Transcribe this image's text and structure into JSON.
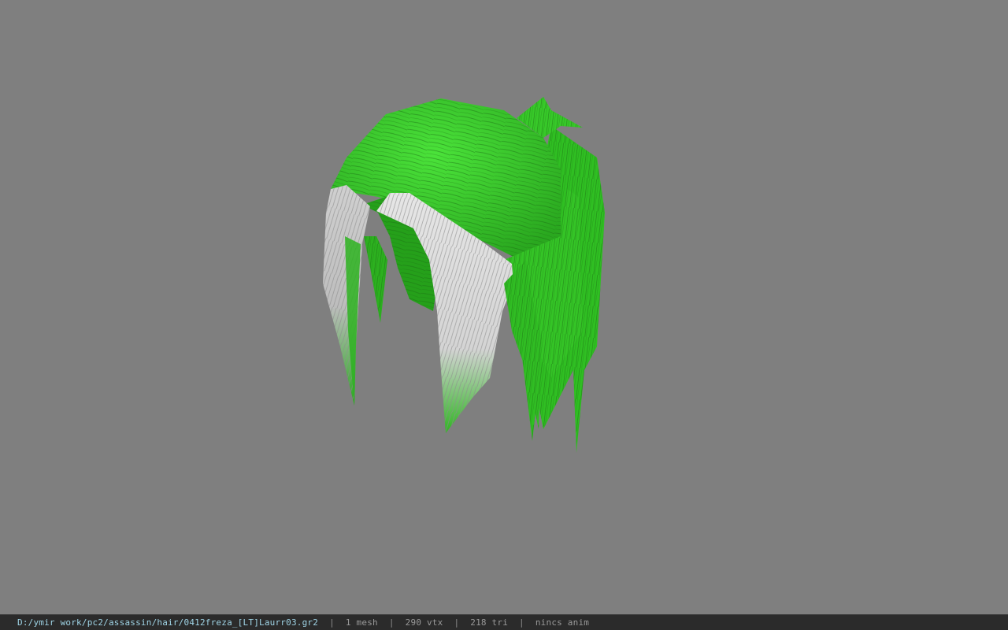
{
  "statusbar": {
    "path": "D:/ymir work/pc2/assassin/hair/0412freza_[LT]Laurr03.gr2",
    "separator": "|",
    "meshes": "1 mesh",
    "vertices": "290 vtx",
    "triangles": "218 tri",
    "animation": "nincs anim"
  },
  "colors": {
    "background": "#7f7f7f",
    "hair_green": "#3fd62e",
    "hair_dark_green": "#22a618",
    "hair_white": "#d9d9d9",
    "statusbar_bg": "#2b2b2b",
    "path_text": "#9fd4e6"
  }
}
